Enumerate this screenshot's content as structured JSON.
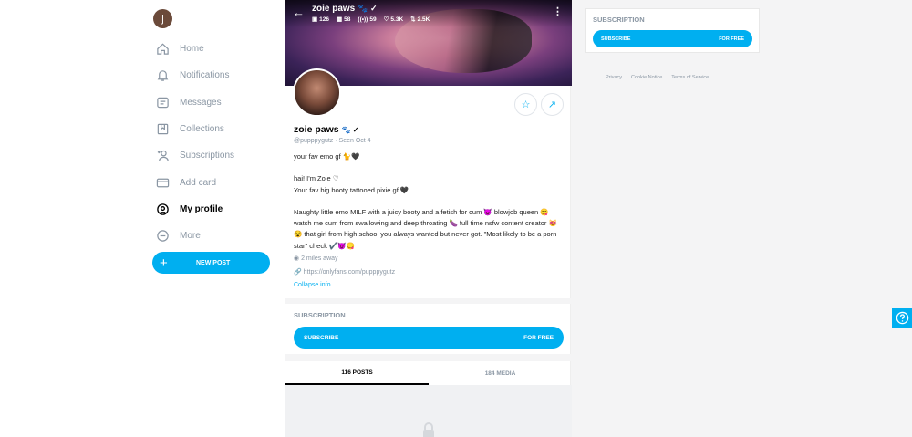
{
  "sidebar": {
    "avatar_initial": "j",
    "items": [
      {
        "label": "Home",
        "icon": "home-icon"
      },
      {
        "label": "Notifications",
        "icon": "bell-icon"
      },
      {
        "label": "Messages",
        "icon": "message-icon"
      },
      {
        "label": "Collections",
        "icon": "bookmark-icon"
      },
      {
        "label": "Subscriptions",
        "icon": "users-icon"
      },
      {
        "label": "Add card",
        "icon": "card-icon"
      },
      {
        "label": "My profile",
        "icon": "profile-icon"
      },
      {
        "label": "More",
        "icon": "more-icon"
      }
    ],
    "new_post_label": "NEW POST"
  },
  "header": {
    "name": "zoie paws",
    "name_badges": "🐾 ✓",
    "stats": {
      "photos": "126",
      "videos": "58",
      "streams": "59",
      "likes": "5.3K",
      "fans": "2.5K"
    }
  },
  "profile": {
    "name": "zoie paws",
    "name_badges": "🐾 ✓",
    "handle": "@pupppygutz",
    "seen": "Seen Oct 4",
    "bio": "your fav emo gf 🐈🖤\n\nhai! I'm Zoie ♡\nYour fav big booty tattooed pixie gf 🖤\n\nNaughty little emo MILF with a juicy booty and a fetish for cum 😈 blowjob queen 😋 watch me cum from swallowing and deep throating 🍆 full time nsfw content creator 😻😵 that girl from high school you always wanted but never got. \"Most likely to be a porn star\" check ✔️😈😋",
    "location": "2 miles away",
    "link": "https://onlyfans.com/pupppygutz",
    "collapse_label": "Collapse info"
  },
  "subscription": {
    "title": "SUBSCRIPTION",
    "button_label": "SUBSCRIBE",
    "price_label": "FOR FREE"
  },
  "tabs": [
    {
      "label": "116 POSTS",
      "active": true
    },
    {
      "label": "184 MEDIA",
      "active": false
    }
  ],
  "right": {
    "title": "SUBSCRIPTION",
    "button_label": "SUBSCRIBE",
    "price_label": "FOR FREE",
    "footer_links": [
      "Privacy",
      "Cookie Notice",
      "Terms of Service"
    ]
  },
  "help_icon": "help-icon",
  "colors": {
    "accent": "#00aff0",
    "muted": "#8a96a3"
  }
}
